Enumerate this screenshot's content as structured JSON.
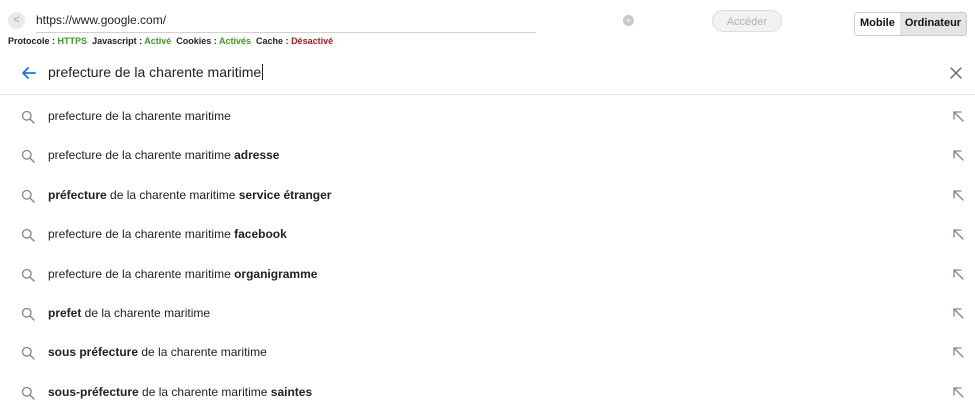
{
  "toolbar": {
    "back_label": "<",
    "url": "https://www.google.com/",
    "go_label": "Accéder",
    "mode_mobile": "Mobile",
    "mode_desktop": "Ordinateur",
    "status": {
      "protocol_label": "Protocole :",
      "protocol_value": "HTTPS",
      "javascript_label": "Javascript :",
      "javascript_value": "Activé",
      "cookies_label": "Cookies :",
      "cookies_value": "Activés",
      "cache_label": "Cache :",
      "cache_value": "Désactivé"
    }
  },
  "search": {
    "query": "prefecture de la charente maritime"
  },
  "suggestions": [
    {
      "parts": [
        {
          "t": "prefecture de la charente maritime",
          "b": false
        }
      ]
    },
    {
      "parts": [
        {
          "t": "prefecture de la charente maritime ",
          "b": false
        },
        {
          "t": "adresse",
          "b": true
        }
      ]
    },
    {
      "parts": [
        {
          "t": "préfecture",
          "b": true
        },
        {
          "t": " de la charente maritime ",
          "b": false
        },
        {
          "t": "service étranger",
          "b": true
        }
      ]
    },
    {
      "parts": [
        {
          "t": "prefecture de la charente maritime ",
          "b": false
        },
        {
          "t": "facebook",
          "b": true
        }
      ]
    },
    {
      "parts": [
        {
          "t": "prefecture de la charente maritime ",
          "b": false
        },
        {
          "t": "organigramme",
          "b": true
        }
      ]
    },
    {
      "parts": [
        {
          "t": "prefet",
          "b": true
        },
        {
          "t": " de la charente maritime",
          "b": false
        }
      ]
    },
    {
      "parts": [
        {
          "t": "sous préfecture",
          "b": true
        },
        {
          "t": " de la charente maritime",
          "b": false
        }
      ]
    },
    {
      "parts": [
        {
          "t": "sous-préfecture",
          "b": true
        },
        {
          "t": " de la charente maritime ",
          "b": false
        },
        {
          "t": "saintes",
          "b": true
        }
      ]
    }
  ],
  "icons": {
    "back": "back-arrow-icon",
    "close": "close-icon",
    "suggestion": "search-icon",
    "fill": "arrow-up-left-icon"
  },
  "colors": {
    "accent": "#1a73e8",
    "enabled": "#3a9a1f",
    "disabled": "#b0181b"
  }
}
